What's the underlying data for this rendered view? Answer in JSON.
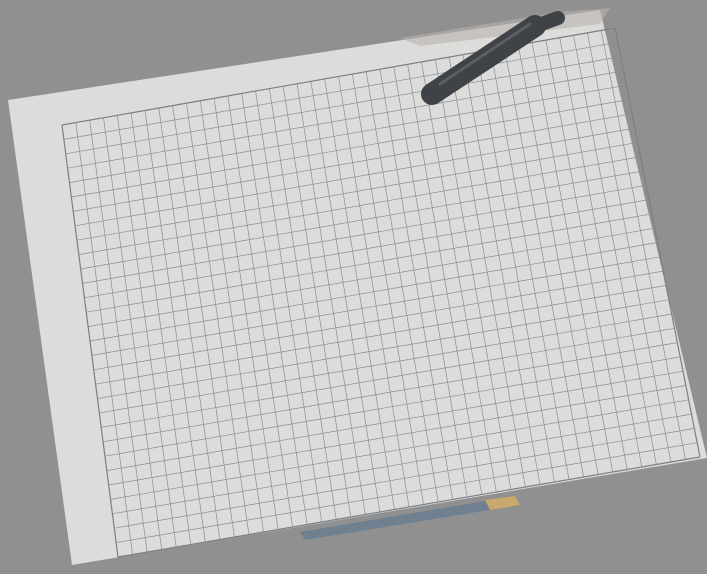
{
  "scene": {
    "subject": "graph paper",
    "colors": {
      "background": "#8f908f",
      "paper": "#dcdcdb",
      "paper_shadow": "#cfd0ce",
      "grid_line": "#8a8d94",
      "border_line": "#7c7f86",
      "pen": "#3f4347",
      "pen_highlight": "#5a5f63",
      "top_edge_strip": "#b7b3ad",
      "bottom_object": "#6f8190",
      "bottom_object_accent": "#c8a86b"
    },
    "grid": {
      "columns": 40,
      "rows": 30
    }
  }
}
